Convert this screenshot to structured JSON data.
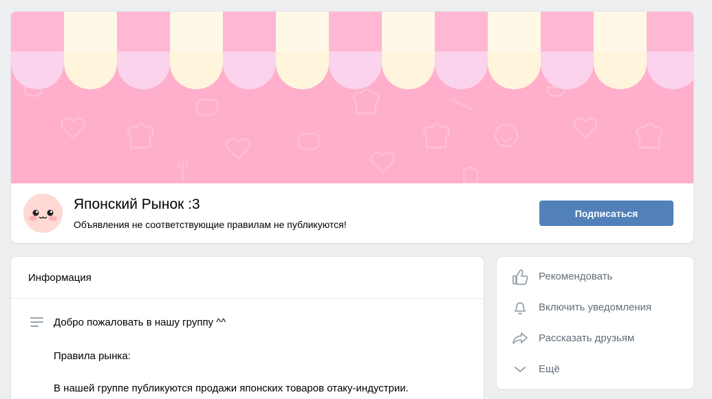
{
  "group": {
    "name": "Японский Рынок :3",
    "status": "Объявления не соответствующие правилам не публикуются!",
    "subscribe_label": "Подписаться"
  },
  "info": {
    "title": "Информация",
    "lines": [
      "Добро пожаловать в нашу группу ^^",
      "Правила рынка:",
      "В нашей группе публикуются продажи японских товаров отаку-индустрии."
    ]
  },
  "actions": [
    {
      "label": "Рекомендовать",
      "icon": "thumbs-up-icon"
    },
    {
      "label": "Включить уведомления",
      "icon": "bell-icon"
    },
    {
      "label": "Рассказать друзьям",
      "icon": "share-icon"
    },
    {
      "label": "Ещё",
      "icon": "chevron-down-icon"
    }
  ],
  "colors": {
    "accent": "#5181b8",
    "cover_pink": "#ffafcb",
    "awning_pink": "#ffc3dc",
    "awning_cream": "#fff8e6",
    "background": "#edeef0"
  }
}
